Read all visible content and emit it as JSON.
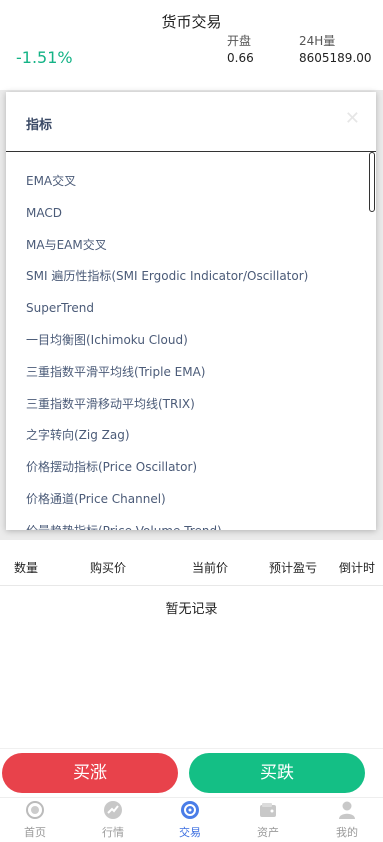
{
  "header": {
    "title": "货币交易"
  },
  "ticker": {
    "change": "-1.51%",
    "stats": [
      {
        "label": "开盘",
        "value": "0.66"
      },
      {
        "label": "24H量",
        "value": "8605189.00"
      }
    ]
  },
  "modal": {
    "title": "指标",
    "close_icon": "close-icon",
    "items": [
      "EMA交叉",
      "MACD",
      "MA与EAM交叉",
      "SMI 遍历性指标(SMI Ergodic Indicator/Oscillator)",
      "SuperTrend",
      "一目均衡图(Ichimoku Cloud)",
      "三重指数平滑平均线(Triple EMA)",
      "三重指数平滑移动平均线(TRIX)",
      "之字转向(Zig Zag)",
      "价格摆动指标(Price Oscillator)",
      "价格通道(Price Channel)",
      "价量趋势指标(Price Volume Trend)"
    ]
  },
  "table": {
    "columns": [
      "数量",
      "购买价",
      "当前价",
      "预计盈亏",
      "倒计时"
    ],
    "empty": "暂无记录"
  },
  "actions": {
    "buy_up": "买涨",
    "buy_down": "买跌"
  },
  "tabbar": {
    "tabs": [
      {
        "label": "首页",
        "icon": "home-icon"
      },
      {
        "label": "行情",
        "icon": "market-icon"
      },
      {
        "label": "交易",
        "icon": "trade-icon",
        "active": true
      },
      {
        "label": "资产",
        "icon": "wallet-icon"
      },
      {
        "label": "我的",
        "icon": "user-icon"
      }
    ]
  },
  "colors": {
    "up": "#e8424b",
    "down": "#14bf85",
    "change": "#14b386",
    "active": "#3b6ee0"
  }
}
